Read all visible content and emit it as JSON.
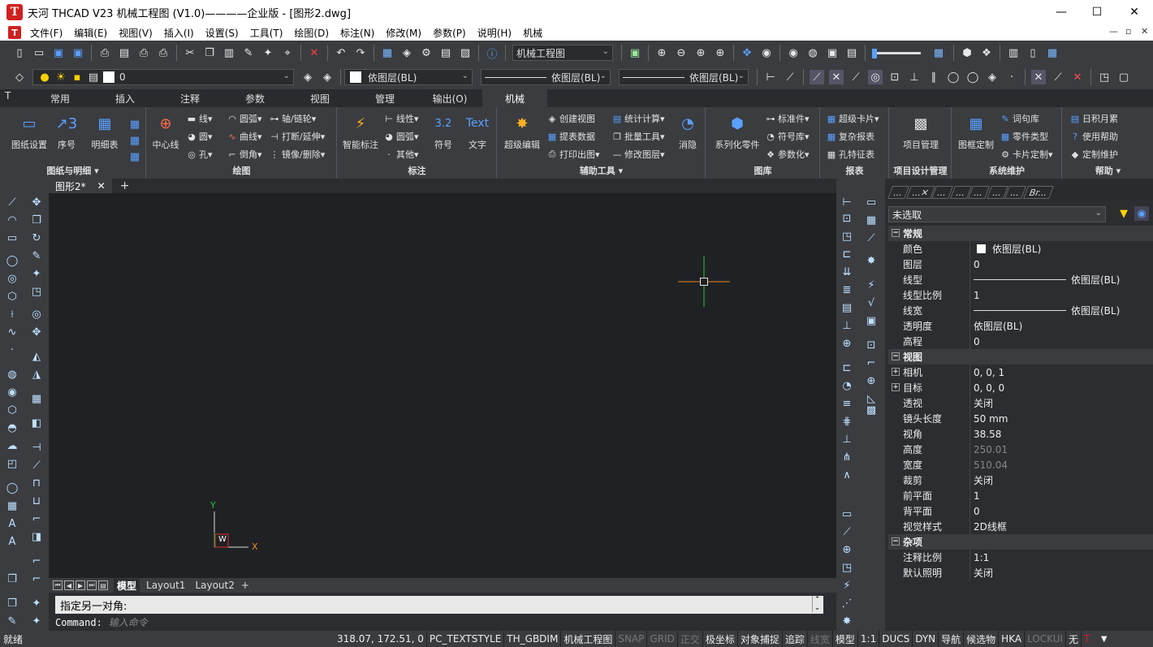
{
  "window": {
    "title": "天河 THCAD V23 机械工程图 (V1.0)————企业版 - [图形2.dwg]",
    "logo": "T",
    "minimize": "—",
    "maximize": "☐",
    "close": "✕"
  },
  "menu": {
    "items": [
      "文件(F)",
      "编辑(E)",
      "视图(V)",
      "插入(I)",
      "设置(S)",
      "工具(T)",
      "绘图(D)",
      "标注(N)",
      "修改(M)",
      "参数(P)",
      "说明(H)",
      "机械"
    ],
    "mdi_min": "—",
    "mdi_restore": "▫",
    "mdi_close": "✕"
  },
  "toolbar1": {
    "workspace": "机械工程图"
  },
  "toolbar2": {
    "layer": "0",
    "color": "依图层(BL)",
    "linetype": "依图层(BL)",
    "lineweight": "依图层(BL)"
  },
  "ribbon": {
    "tabs": [
      "常用",
      "插入",
      "注释",
      "参数",
      "视图",
      "管理",
      "输出(O)",
      "机械"
    ],
    "active_tab": "机械",
    "groups": {
      "g1": {
        "title": "图纸与明细 ▾",
        "b1": "图纸设置",
        "b2": "序号",
        "b3": "明细表"
      },
      "g2": {
        "title": "绘图",
        "big": "中心线",
        "s1": "线▾",
        "s2": "圆弧▾",
        "s3": "轴/链轮▾",
        "s4": "圆▾",
        "s5": "曲线▾",
        "s6": "打断/延伸▾",
        "s7": "孔▾",
        "s8": "倒角▾",
        "s9": "镜像/删除▾"
      },
      "g3": {
        "title": "标注",
        "big": "智能标注",
        "s1": "线性▾",
        "s2": "圆弧▾",
        "s3": "其他▾",
        "b2": "符号",
        "b3": "文字",
        "b3icon": "Text"
      },
      "g4": {
        "title": "辅助工具 ▾",
        "big": "超级编辑",
        "s1": "创建视图",
        "s2": "提表数据",
        "s3": "打印出图▾",
        "s4": "统计计算▾",
        "s5": "批量工具▾",
        "s6": "修改图层▾",
        "b2": "消隐"
      },
      "g5": {
        "title": "图库",
        "big": "系列化零件",
        "s1": "标准件▾",
        "s2": "符号库▾",
        "s3": "参数化▾"
      },
      "g6": {
        "title": "报表",
        "s1": "超级卡片▾",
        "s2": "复杂报表",
        "s3": "孔特征表"
      },
      "g7": {
        "title": "项目设计管理",
        "big": "项目管理"
      },
      "g8": {
        "title": "系统维护",
        "big": "图框定制",
        "s1": "词句库",
        "s2": "零件类型",
        "s3": "卡片定制▾"
      },
      "g9": {
        "title": "帮助 ▾",
        "s1": "日积月累",
        "s2": "使用帮助",
        "s3": "定制维护"
      }
    }
  },
  "document": {
    "tab": "图形2*",
    "close": "✕",
    "add": "+"
  },
  "ucs": {
    "y": "Y",
    "x": "X",
    "w": "W"
  },
  "layouts": {
    "model": "模型",
    "l1": "Layout1",
    "l2": "Layout2",
    "add": "+"
  },
  "command": {
    "prompt": "指定另一对角:",
    "label": "Command:",
    "placeholder": "输入命令"
  },
  "properties": {
    "tabs": [
      "...",
      "...✕",
      "...",
      "...",
      "...",
      "...",
      "...",
      "Br..."
    ],
    "selection": "未选取",
    "sections": {
      "general": "常规",
      "view": "视图",
      "misc": "杂项"
    },
    "rows": {
      "color_k": "颜色",
      "color_v": "依图层(BL)",
      "layer_k": "图层",
      "layer_v": "0",
      "ltype_k": "线型",
      "ltype_v": "依图层(BL)",
      "lscale_k": "线型比例",
      "lscale_v": "1",
      "lweight_k": "线宽",
      "lweight_v": "依图层(BL)",
      "trans_k": "透明度",
      "trans_v": "依图层(BL)",
      "elev_k": "高程",
      "elev_v": "0",
      "camera_k": "相机",
      "camera_v": "0, 0, 1",
      "target_k": "目标",
      "target_v": "0, 0, 0",
      "persp_k": "透视",
      "persp_v": "关闭",
      "lens_k": "镜头长度",
      "lens_v": "50 mm",
      "fov_k": "视角",
      "fov_v": "38.58",
      "height_k": "高度",
      "height_v": "250.01",
      "width_k": "宽度",
      "width_v": "510.04",
      "clip_k": "裁剪",
      "clip_v": "关闭",
      "front_k": "前平面",
      "front_v": "1",
      "back_k": "背平面",
      "back_v": "0",
      "vstyle_k": "视觉样式",
      "vstyle_v": "2D线框",
      "ascale_k": "注释比例",
      "ascale_v": "1:1",
      "light_k": "默认照明",
      "light_v": "关闭"
    }
  },
  "status": {
    "ready": "就绪",
    "coords": "318.07, 172.51, 0",
    "textstyle": "PC_TEXTSTYLE",
    "dimstyle": "TH_GBDIM",
    "workspace": "机械工程图",
    "snap": "SNAP",
    "grid": "GRID",
    "ortho": "正交",
    "polar": "极坐标",
    "osnap": "对象捕捉",
    "otrack": "追踪",
    "lwt": "线宽",
    "model": "模型",
    "scale": "1:1",
    "ducs": "DUCS",
    "dyn": "DYN",
    "nav": "导航",
    "qp": "候选物",
    "hka": "HKA",
    "lockui": "LOCKUI",
    "none": "无"
  },
  "colors": {
    "accent": "#1e88e5",
    "crosshair_h": "#e08a2a",
    "crosshair_v": "#27c13a"
  }
}
